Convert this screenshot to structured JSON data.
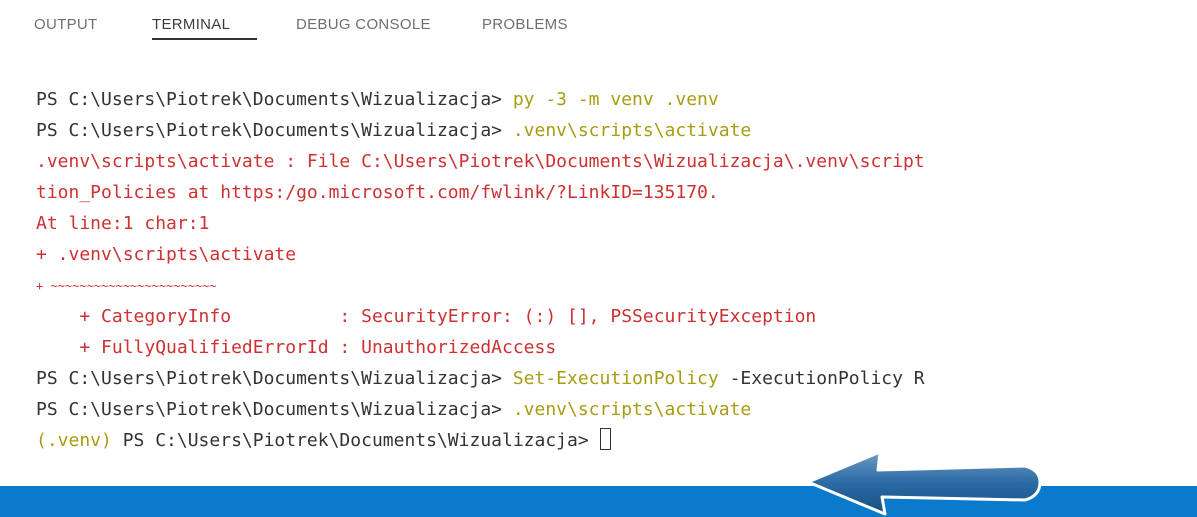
{
  "tabs": [
    {
      "label": "OUTPUT",
      "active": false
    },
    {
      "label": "TERMINAL",
      "active": true
    },
    {
      "label": "DEBUG CONSOLE",
      "active": false
    },
    {
      "label": "PROBLEMS",
      "active": false
    }
  ],
  "terminal": {
    "prompt": "PS C:\\Users\\Piotrek\\Documents\\Wizualizacja> ",
    "line1_cmd": "py -3 -m venv .venv",
    "line2_cmd": ".venv\\scripts\\activate",
    "line3_err": ".venv\\scripts\\activate : File C:\\Users\\Piotrek\\Documents\\Wizualizacja\\.venv\\script",
    "line4_err": "tion_Policies at https:/go.microsoft.com/fwlink/?LinkID=135170.",
    "line5_err": "At line:1 char:1",
    "line6_err": "+ .venv\\scripts\\activate",
    "line7_err": "+ ~~~~~~~~~~~~~~~~~~~~~~~",
    "line8_err": "    + CategoryInfo          : SecurityError: (:) [], PSSecurityException",
    "line9_err": "    + FullyQualifiedErrorId : UnauthorizedAccess",
    "line10_cmd": "Set-ExecutionPolicy",
    "line10_rest": " -ExecutionPolicy R",
    "line11_cmd": ".venv\\scripts\\activate",
    "line12_venv": "(.venv)",
    "line12_prompt": " PS C:\\Users\\Piotrek\\Documents\\Wizualizacja> "
  },
  "colors": {
    "command": "#a89d12",
    "error": "#cd3131",
    "status_bar": "#0a7acc",
    "arrow": "#1f5c8f"
  },
  "annotation": {
    "icon": "arrow-left-icon"
  }
}
